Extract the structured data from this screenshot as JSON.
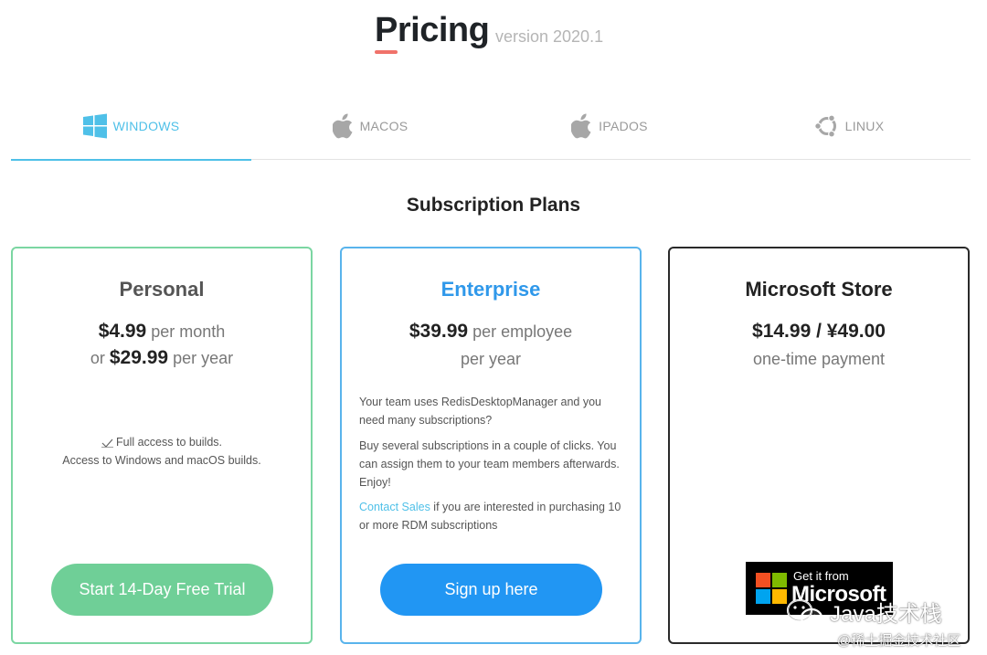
{
  "header": {
    "title": "Pricing",
    "version": "version 2020.1"
  },
  "tabs": [
    {
      "label": "WINDOWS",
      "icon": "windows-icon",
      "active": true
    },
    {
      "label": "MACOS",
      "icon": "apple-icon",
      "active": false
    },
    {
      "label": "IPADOS",
      "icon": "apple-icon",
      "active": false
    },
    {
      "label": "LINUX",
      "icon": "ubuntu-icon",
      "active": false
    }
  ],
  "section_title": "Subscription Plans",
  "plans": {
    "personal": {
      "name": "Personal",
      "price1": "$4.99",
      "price1_suffix": " per month",
      "price2_prefix": "or ",
      "price2": "$29.99",
      "price2_suffix": " per year",
      "feature1": "Full access to builds.",
      "feature2": "Access to Windows and macOS builds.",
      "button": "Start 14-Day Free Trial"
    },
    "enterprise": {
      "name": "Enterprise",
      "price": "$39.99",
      "price_suffix": " per employee",
      "price_suffix2": "per year",
      "desc1": "Your team uses RedisDesktopManager and you need many subscriptions?",
      "desc2": "Buy several subscriptions in a couple of clicks. You can assign them to your team members afterwards. Enjoy!",
      "desc3_link": "Contact Sales",
      "desc3": " if you are interested in purchasing 10 or more RDM subscriptions",
      "button": "Sign up here"
    },
    "store": {
      "name": "Microsoft Store",
      "price": "$14.99 / ¥49.00",
      "price_suffix": "one-time payment",
      "badge_line1": "Get it from",
      "badge_line2": "Microsoft"
    }
  },
  "watermark": {
    "main": "Java技术栈",
    "sub": "@稀土掘金技术社区"
  },
  "colors": {
    "accent": "#4fc0e8",
    "title_underline": "#f0726a",
    "green_button": "#6fcf97",
    "blue_button": "#2196f3",
    "ms_red": "#f25022",
    "ms_green": "#7fba00",
    "ms_blue": "#00a4ef",
    "ms_yellow": "#ffb900"
  }
}
